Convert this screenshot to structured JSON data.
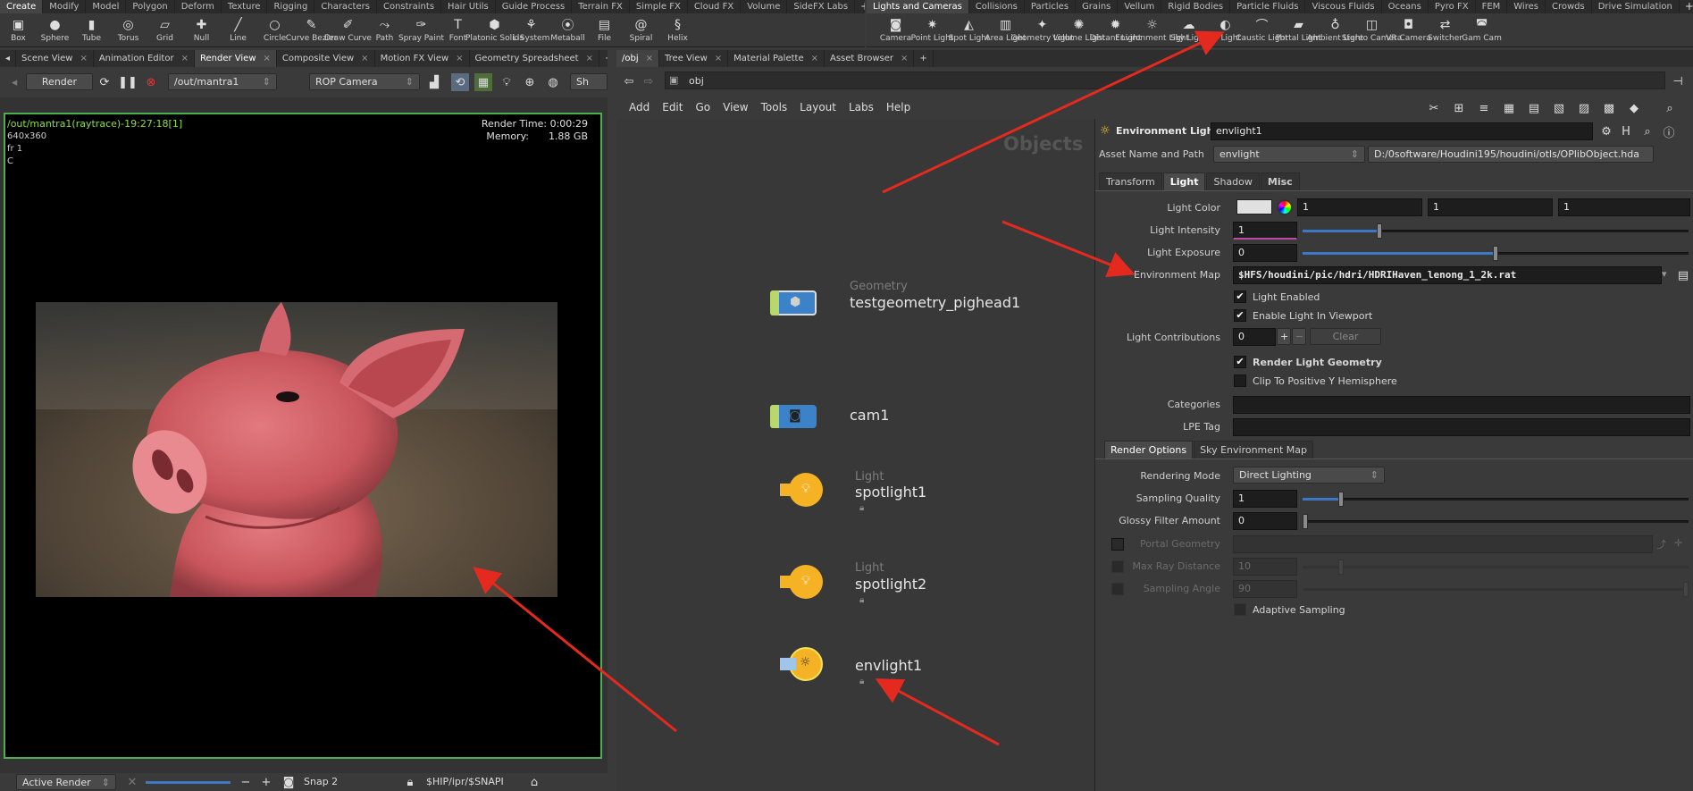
{
  "top_tabs_left": [
    "Create",
    "Modify",
    "Model",
    "Polygon",
    "Deform",
    "Texture",
    "Rigging",
    "Characters",
    "Constraints",
    "Hair Utils",
    "Guide Process",
    "Terrain FX",
    "Simple FX",
    "Cloud FX",
    "Volume",
    "SideFX Labs"
  ],
  "top_tabs_right": [
    "Lights and Cameras",
    "Collisions",
    "Particles",
    "Grains",
    "Vellum",
    "Rigid Bodies",
    "Particle Fluids",
    "Viscous Fluids",
    "Oceans",
    "Pyro FX",
    "FEM",
    "Wires",
    "Crowds",
    "Drive Simulation"
  ],
  "shelf_left": [
    {
      "label": "Box",
      "icon": "box-icon",
      "glyph": "▣"
    },
    {
      "label": "Sphere",
      "icon": "sphere-icon",
      "glyph": "●"
    },
    {
      "label": "Tube",
      "icon": "tube-icon",
      "glyph": "▮"
    },
    {
      "label": "Torus",
      "icon": "torus-icon",
      "glyph": "◎"
    },
    {
      "label": "Grid",
      "icon": "grid-icon",
      "glyph": "▱"
    },
    {
      "label": "Null",
      "icon": "null-icon",
      "glyph": "✚"
    },
    {
      "label": "Line",
      "icon": "line-icon",
      "glyph": "╱"
    },
    {
      "label": "Circle",
      "icon": "circle-icon",
      "glyph": "○"
    },
    {
      "label": "Curve Bezier",
      "icon": "curve-bezier-icon",
      "glyph": "✎"
    },
    {
      "label": "Draw Curve",
      "icon": "draw-curve-icon",
      "glyph": "✐"
    },
    {
      "label": "Path",
      "icon": "path-icon",
      "glyph": "⤳"
    },
    {
      "label": "Spray Paint",
      "icon": "spray-paint-icon",
      "glyph": "✑"
    },
    {
      "label": "Font",
      "icon": "font-icon",
      "glyph": "T"
    },
    {
      "label": "Platonic Solids",
      "icon": "platonic-solids-icon",
      "glyph": "⬢"
    },
    {
      "label": "L-System",
      "icon": "l-system-icon",
      "glyph": "⚘"
    },
    {
      "label": "Metaball",
      "icon": "metaball-icon",
      "glyph": "⦿"
    },
    {
      "label": "File",
      "icon": "file-icon",
      "glyph": "▤"
    },
    {
      "label": "Spiral",
      "icon": "spiral-icon",
      "glyph": "@"
    },
    {
      "label": "Helix",
      "icon": "helix-icon",
      "glyph": "§"
    }
  ],
  "shelf_right": [
    {
      "label": "Camera",
      "icon": "camera-icon",
      "glyph": "◙"
    },
    {
      "label": "Point Light",
      "icon": "point-light-icon",
      "glyph": "✷"
    },
    {
      "label": "Spot Light",
      "icon": "spot-light-icon",
      "glyph": "◭"
    },
    {
      "label": "Area Light",
      "icon": "area-light-icon",
      "glyph": "▥"
    },
    {
      "label": "Geometry Light",
      "icon": "geometry-light-icon",
      "glyph": "✦"
    },
    {
      "label": "Volume Light",
      "icon": "volume-light-icon",
      "glyph": "✺"
    },
    {
      "label": "Distant Light",
      "icon": "distant-light-icon",
      "glyph": "✹"
    },
    {
      "label": "Environment Light",
      "icon": "environment-light-icon",
      "glyph": "☼"
    },
    {
      "label": "Sky Light",
      "icon": "sky-light-icon",
      "glyph": "☁"
    },
    {
      "label": "GI Light",
      "icon": "gi-light-icon",
      "glyph": "◐"
    },
    {
      "label": "Caustic Light",
      "icon": "caustic-light-icon",
      "glyph": "⌒"
    },
    {
      "label": "Portal Light",
      "icon": "portal-light-icon",
      "glyph": "▰"
    },
    {
      "label": "Ambient Light",
      "icon": "ambient-light-icon",
      "glyph": "♁"
    },
    {
      "label": "Stereo Camera",
      "icon": "stereo-camera-icon",
      "glyph": "◫"
    },
    {
      "label": "VR Camera",
      "icon": "vr-camera-icon",
      "glyph": "◘"
    },
    {
      "label": "Switcher",
      "icon": "switcher-icon",
      "glyph": "⇄"
    },
    {
      "label": "Gam Cam",
      "icon": "gamepad-camera-icon",
      "glyph": "◚"
    }
  ],
  "left_pane_tabs": [
    "Scene View",
    "Animation Editor",
    "Render View",
    "Composite View",
    "Motion FX View",
    "Geometry Spreadsheet"
  ],
  "right_pane_tabs": [
    "/obj",
    "Tree View",
    "Material Palette",
    "Asset Browser"
  ],
  "render_toolbar": {
    "render_label": "Render",
    "rop_path": "/out/mantra1",
    "camera": "ROP Camera",
    "sh_label": "Sh"
  },
  "render_info": {
    "title": "/out/mantra1(raytrace)-19:27:18[1]",
    "resolution": "640x360",
    "frame": "fr 1",
    "channel": "C",
    "render_time": "Render Time: 0:00:29",
    "memory_label": "Memory:",
    "memory_value": "1.88 GB"
  },
  "render_bottom": {
    "active_render": "Active Render",
    "snap": "Snap 2",
    "path": "$HIP/ipr/$SNAPI"
  },
  "network": {
    "path": "obj",
    "menu": [
      "Add",
      "Edit",
      "Go",
      "View",
      "Tools",
      "Layout",
      "Labs",
      "Help"
    ],
    "watermark": "Objects",
    "nodes": [
      {
        "type": "Geometry",
        "name": "testgeometry_pighead1"
      },
      {
        "type": "",
        "name": "cam1"
      },
      {
        "type": "Light",
        "name": "spotlight1"
      },
      {
        "type": "Light",
        "name": "spotlight2"
      },
      {
        "type": "",
        "name": "envlight1"
      }
    ]
  },
  "params": {
    "node_type": "Environment Light",
    "node_name": "envlight1",
    "asset_label": "Asset Name and Path",
    "asset_name": "envlight",
    "asset_path": "D:/0software/Houdini195/houdini/otls/OPlibObject.hda",
    "tabs": [
      "Transform",
      "Light",
      "Shadow",
      "Misc"
    ],
    "light_color_label": "Light Color",
    "light_color": [
      "1",
      "1",
      "1"
    ],
    "light_intensity_label": "Light Intensity",
    "light_intensity": "1",
    "light_exposure_label": "Light Exposure",
    "light_exposure": "0",
    "env_map_label": "Environment Map",
    "env_map": "$HFS/houdini/pic/hdri/HDRIHaven_lenong_1_2k.rat",
    "light_enabled": "Light Enabled",
    "enable_viewport": "Enable Light In Viewport",
    "contrib_label": "Light Contributions",
    "contrib_value": "0",
    "clear": "Clear",
    "render_geo": "Render Light Geometry",
    "clip_hemi": "Clip To Positive Y Hemisphere",
    "categories_label": "Categories",
    "lpe_label": "LPE Tag",
    "subtabs": [
      "Render Options",
      "Sky Environment Map"
    ],
    "rendering_mode_label": "Rendering Mode",
    "rendering_mode": "Direct Lighting",
    "sampling_quality_label": "Sampling Quality",
    "sampling_quality": "1",
    "glossy_label": "Glossy Filter Amount",
    "glossy": "0",
    "portal_geo_label": "Portal Geometry",
    "max_ray_label": "Max Ray Distance",
    "max_ray": "10",
    "sampling_angle_label": "Sampling Angle",
    "sampling_angle": "90",
    "adaptive": "Adaptive Sampling",
    "intensity_level": 0.2,
    "exposure_level": 0.5,
    "sampling_level": 0.1
  },
  "colors": {
    "accent": "#3d78c7",
    "arrow": "#e42a1f",
    "render_border": "#4caf50",
    "title_green": "#8ddd44"
  }
}
